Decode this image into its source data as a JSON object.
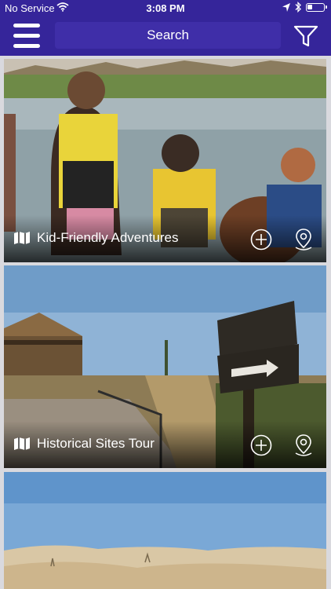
{
  "status_bar": {
    "carrier": "No Service",
    "time": "3:08 PM"
  },
  "header": {
    "search_label": "Search"
  },
  "cards": [
    {
      "title": "Kid-Friendly Adventures"
    },
    {
      "title": "Historical Sites Tour"
    },
    {
      "title": ""
    }
  ],
  "colors": {
    "header_bg": "#35259a",
    "search_bg": "#3f2ea8",
    "page_bg": "#d9d9de"
  },
  "icons": [
    "wifi-icon",
    "location-arrow-icon",
    "bluetooth-icon",
    "battery-icon",
    "hamburger-menu-icon",
    "filter-funnel-icon",
    "map-icon",
    "plus-circle-icon",
    "map-pin-icon"
  ]
}
